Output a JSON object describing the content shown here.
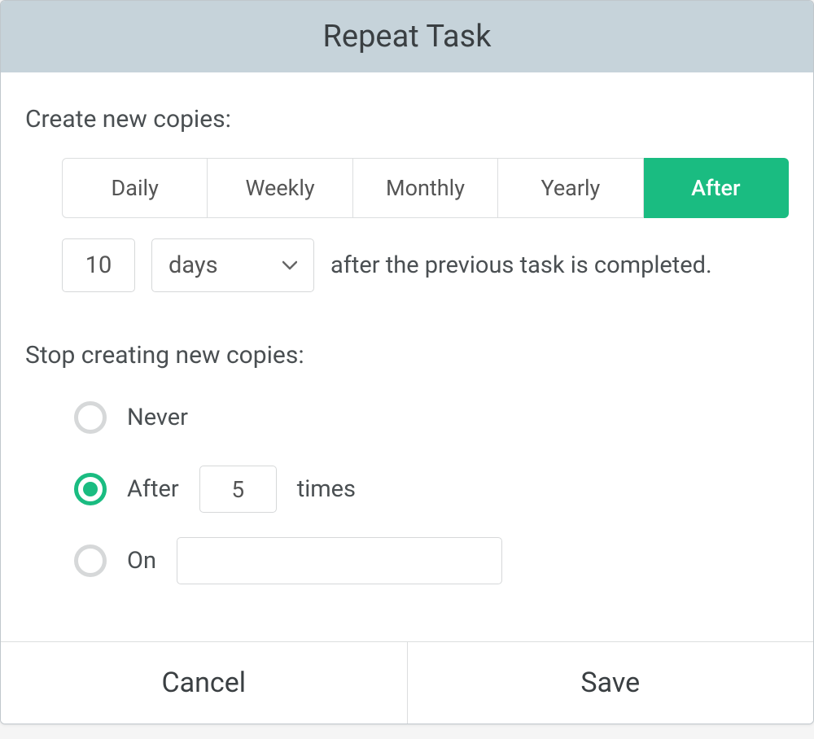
{
  "dialog": {
    "title": "Repeat Task"
  },
  "create": {
    "label": "Create new copies:",
    "tabs": [
      {
        "label": "Daily",
        "active": false
      },
      {
        "label": "Weekly",
        "active": false
      },
      {
        "label": "Monthly",
        "active": false
      },
      {
        "label": "Yearly",
        "active": false
      },
      {
        "label": "After",
        "active": true
      }
    ],
    "interval_value": "10",
    "interval_unit": "days",
    "after_text": "after the previous task is completed."
  },
  "stop": {
    "label": "Stop creating new copies:",
    "options": {
      "never": {
        "label": "Never",
        "selected": false
      },
      "after": {
        "label_prefix": "After",
        "value": "5",
        "label_suffix": "times",
        "selected": true
      },
      "on": {
        "label": "On",
        "value": "",
        "selected": false
      }
    }
  },
  "footer": {
    "cancel": "Cancel",
    "save": "Save"
  }
}
